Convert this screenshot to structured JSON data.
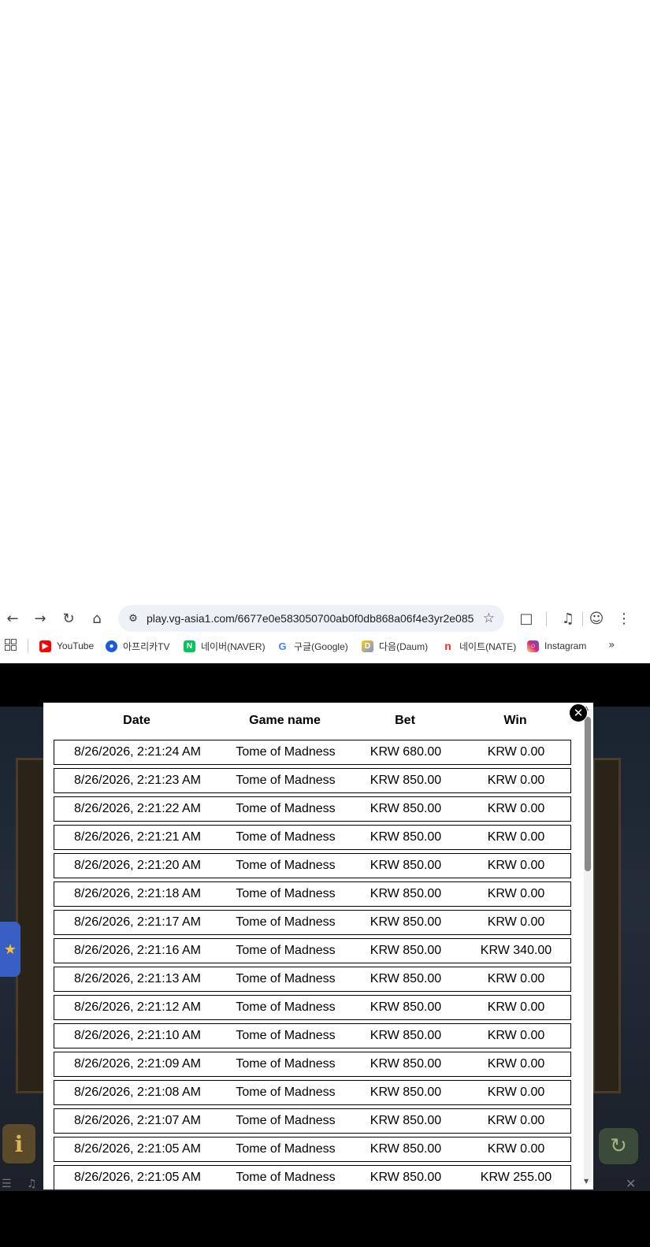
{
  "browser": {
    "url": "play.vg-asia1.com/6677e0e583050700ab0f0db868a06f4e3yr2e085",
    "bookmarks": [
      {
        "label": "YouTube",
        "icon": "youtube-icon",
        "color": "#ff0000"
      },
      {
        "label": "아프리카TV",
        "icon": "afreecatv-icon",
        "color": "#1e5bd8"
      },
      {
        "label": "네이버(NAVER)",
        "icon": "naver-icon",
        "color": "#03c75a"
      },
      {
        "label": "구글(Google)",
        "icon": "google-icon",
        "color": "#4285f4"
      },
      {
        "label": "다음(Daum)",
        "icon": "daum-icon",
        "color": "#ffcd00"
      },
      {
        "label": "네이트(NATE)",
        "icon": "nate-icon",
        "color": "#ff2a2a"
      },
      {
        "label": "Instagram",
        "icon": "instagram-icon",
        "color": "#d62976"
      }
    ]
  },
  "history": {
    "headers": {
      "date": "Date",
      "game": "Game name",
      "bet": "Bet",
      "win": "Win"
    },
    "rows": [
      {
        "date": "8/26/2026, 2:21:24 AM",
        "game": "Tome of Madness",
        "bet": "KRW 680.00",
        "win": "KRW 0.00"
      },
      {
        "date": "8/26/2026, 2:21:23 AM",
        "game": "Tome of Madness",
        "bet": "KRW 850.00",
        "win": "KRW 0.00"
      },
      {
        "date": "8/26/2026, 2:21:22 AM",
        "game": "Tome of Madness",
        "bet": "KRW 850.00",
        "win": "KRW 0.00"
      },
      {
        "date": "8/26/2026, 2:21:21 AM",
        "game": "Tome of Madness",
        "bet": "KRW 850.00",
        "win": "KRW 0.00"
      },
      {
        "date": "8/26/2026, 2:21:20 AM",
        "game": "Tome of Madness",
        "bet": "KRW 850.00",
        "win": "KRW 0.00"
      },
      {
        "date": "8/26/2026, 2:21:18 AM",
        "game": "Tome of Madness",
        "bet": "KRW 850.00",
        "win": "KRW 0.00"
      },
      {
        "date": "8/26/2026, 2:21:17 AM",
        "game": "Tome of Madness",
        "bet": "KRW 850.00",
        "win": "KRW 0.00"
      },
      {
        "date": "8/26/2026, 2:21:16 AM",
        "game": "Tome of Madness",
        "bet": "KRW 850.00",
        "win": "KRW 340.00"
      },
      {
        "date": "8/26/2026, 2:21:13 AM",
        "game": "Tome of Madness",
        "bet": "KRW 850.00",
        "win": "KRW 0.00"
      },
      {
        "date": "8/26/2026, 2:21:12 AM",
        "game": "Tome of Madness",
        "bet": "KRW 850.00",
        "win": "KRW 0.00"
      },
      {
        "date": "8/26/2026, 2:21:10 AM",
        "game": "Tome of Madness",
        "bet": "KRW 850.00",
        "win": "KRW 0.00"
      },
      {
        "date": "8/26/2026, 2:21:09 AM",
        "game": "Tome of Madness",
        "bet": "KRW 850.00",
        "win": "KRW 0.00"
      },
      {
        "date": "8/26/2026, 2:21:08 AM",
        "game": "Tome of Madness",
        "bet": "KRW 850.00",
        "win": "KRW 0.00"
      },
      {
        "date": "8/26/2026, 2:21:07 AM",
        "game": "Tome of Madness",
        "bet": "KRW 850.00",
        "win": "KRW 0.00"
      },
      {
        "date": "8/26/2026, 2:21:05 AM",
        "game": "Tome of Madness",
        "bet": "KRW 850.00",
        "win": "KRW 0.00"
      },
      {
        "date": "8/26/2026, 2:21:05 AM",
        "game": "Tome of Madness",
        "bet": "KRW 850.00",
        "win": "KRW 255.00"
      }
    ]
  }
}
